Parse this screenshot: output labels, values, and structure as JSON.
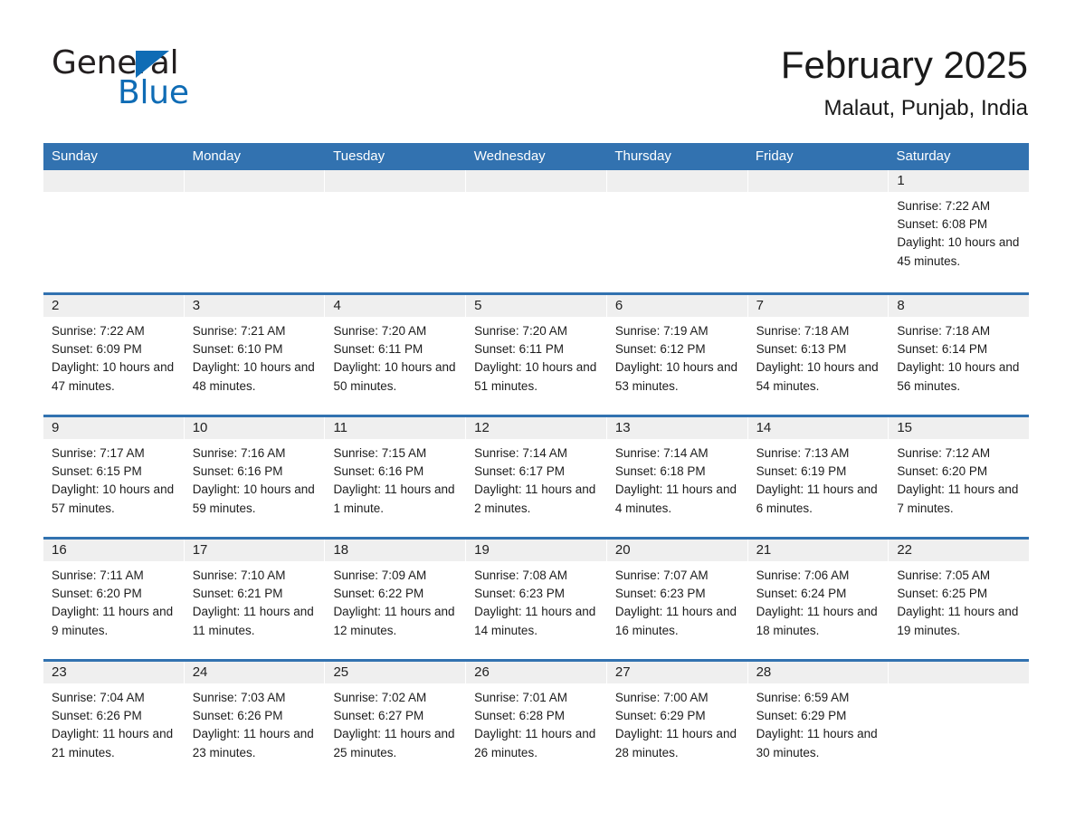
{
  "brand": {
    "name_part1": "General",
    "name_part2": "Blue",
    "accent_color": "#0f6cb5"
  },
  "header": {
    "title": "February 2025",
    "subtitle": "Malaut, Punjab, India"
  },
  "theme": {
    "header_blue": "#3272b0",
    "day_band_gray": "#efefef",
    "text_color": "#1c1c1c"
  },
  "weekdays": [
    "Sunday",
    "Monday",
    "Tuesday",
    "Wednesday",
    "Thursday",
    "Friday",
    "Saturday"
  ],
  "weeks": [
    [
      {
        "day": "",
        "empty": true
      },
      {
        "day": "",
        "empty": true
      },
      {
        "day": "",
        "empty": true
      },
      {
        "day": "",
        "empty": true
      },
      {
        "day": "",
        "empty": true
      },
      {
        "day": "",
        "empty": true
      },
      {
        "day": "1",
        "sunrise": "Sunrise: 7:22 AM",
        "sunset": "Sunset: 6:08 PM",
        "daylight": "Daylight: 10 hours and 45 minutes."
      }
    ],
    [
      {
        "day": "2",
        "sunrise": "Sunrise: 7:22 AM",
        "sunset": "Sunset: 6:09 PM",
        "daylight": "Daylight: 10 hours and 47 minutes."
      },
      {
        "day": "3",
        "sunrise": "Sunrise: 7:21 AM",
        "sunset": "Sunset: 6:10 PM",
        "daylight": "Daylight: 10 hours and 48 minutes."
      },
      {
        "day": "4",
        "sunrise": "Sunrise: 7:20 AM",
        "sunset": "Sunset: 6:11 PM",
        "daylight": "Daylight: 10 hours and 50 minutes."
      },
      {
        "day": "5",
        "sunrise": "Sunrise: 7:20 AM",
        "sunset": "Sunset: 6:11 PM",
        "daylight": "Daylight: 10 hours and 51 minutes."
      },
      {
        "day": "6",
        "sunrise": "Sunrise: 7:19 AM",
        "sunset": "Sunset: 6:12 PM",
        "daylight": "Daylight: 10 hours and 53 minutes."
      },
      {
        "day": "7",
        "sunrise": "Sunrise: 7:18 AM",
        "sunset": "Sunset: 6:13 PM",
        "daylight": "Daylight: 10 hours and 54 minutes."
      },
      {
        "day": "8",
        "sunrise": "Sunrise: 7:18 AM",
        "sunset": "Sunset: 6:14 PM",
        "daylight": "Daylight: 10 hours and 56 minutes."
      }
    ],
    [
      {
        "day": "9",
        "sunrise": "Sunrise: 7:17 AM",
        "sunset": "Sunset: 6:15 PM",
        "daylight": "Daylight: 10 hours and 57 minutes."
      },
      {
        "day": "10",
        "sunrise": "Sunrise: 7:16 AM",
        "sunset": "Sunset: 6:16 PM",
        "daylight": "Daylight: 10 hours and 59 minutes."
      },
      {
        "day": "11",
        "sunrise": "Sunrise: 7:15 AM",
        "sunset": "Sunset: 6:16 PM",
        "daylight": "Daylight: 11 hours and 1 minute."
      },
      {
        "day": "12",
        "sunrise": "Sunrise: 7:14 AM",
        "sunset": "Sunset: 6:17 PM",
        "daylight": "Daylight: 11 hours and 2 minutes."
      },
      {
        "day": "13",
        "sunrise": "Sunrise: 7:14 AM",
        "sunset": "Sunset: 6:18 PM",
        "daylight": "Daylight: 11 hours and 4 minutes."
      },
      {
        "day": "14",
        "sunrise": "Sunrise: 7:13 AM",
        "sunset": "Sunset: 6:19 PM",
        "daylight": "Daylight: 11 hours and 6 minutes."
      },
      {
        "day": "15",
        "sunrise": "Sunrise: 7:12 AM",
        "sunset": "Sunset: 6:20 PM",
        "daylight": "Daylight: 11 hours and 7 minutes."
      }
    ],
    [
      {
        "day": "16",
        "sunrise": "Sunrise: 7:11 AM",
        "sunset": "Sunset: 6:20 PM",
        "daylight": "Daylight: 11 hours and 9 minutes."
      },
      {
        "day": "17",
        "sunrise": "Sunrise: 7:10 AM",
        "sunset": "Sunset: 6:21 PM",
        "daylight": "Daylight: 11 hours and 11 minutes."
      },
      {
        "day": "18",
        "sunrise": "Sunrise: 7:09 AM",
        "sunset": "Sunset: 6:22 PM",
        "daylight": "Daylight: 11 hours and 12 minutes."
      },
      {
        "day": "19",
        "sunrise": "Sunrise: 7:08 AM",
        "sunset": "Sunset: 6:23 PM",
        "daylight": "Daylight: 11 hours and 14 minutes."
      },
      {
        "day": "20",
        "sunrise": "Sunrise: 7:07 AM",
        "sunset": "Sunset: 6:23 PM",
        "daylight": "Daylight: 11 hours and 16 minutes."
      },
      {
        "day": "21",
        "sunrise": "Sunrise: 7:06 AM",
        "sunset": "Sunset: 6:24 PM",
        "daylight": "Daylight: 11 hours and 18 minutes."
      },
      {
        "day": "22",
        "sunrise": "Sunrise: 7:05 AM",
        "sunset": "Sunset: 6:25 PM",
        "daylight": "Daylight: 11 hours and 19 minutes."
      }
    ],
    [
      {
        "day": "23",
        "sunrise": "Sunrise: 7:04 AM",
        "sunset": "Sunset: 6:26 PM",
        "daylight": "Daylight: 11 hours and 21 minutes."
      },
      {
        "day": "24",
        "sunrise": "Sunrise: 7:03 AM",
        "sunset": "Sunset: 6:26 PM",
        "daylight": "Daylight: 11 hours and 23 minutes."
      },
      {
        "day": "25",
        "sunrise": "Sunrise: 7:02 AM",
        "sunset": "Sunset: 6:27 PM",
        "daylight": "Daylight: 11 hours and 25 minutes."
      },
      {
        "day": "26",
        "sunrise": "Sunrise: 7:01 AM",
        "sunset": "Sunset: 6:28 PM",
        "daylight": "Daylight: 11 hours and 26 minutes."
      },
      {
        "day": "27",
        "sunrise": "Sunrise: 7:00 AM",
        "sunset": "Sunset: 6:29 PM",
        "daylight": "Daylight: 11 hours and 28 minutes."
      },
      {
        "day": "28",
        "sunrise": "Sunrise: 6:59 AM",
        "sunset": "Sunset: 6:29 PM",
        "daylight": "Daylight: 11 hours and 30 minutes."
      },
      {
        "day": "",
        "empty": true
      }
    ]
  ]
}
